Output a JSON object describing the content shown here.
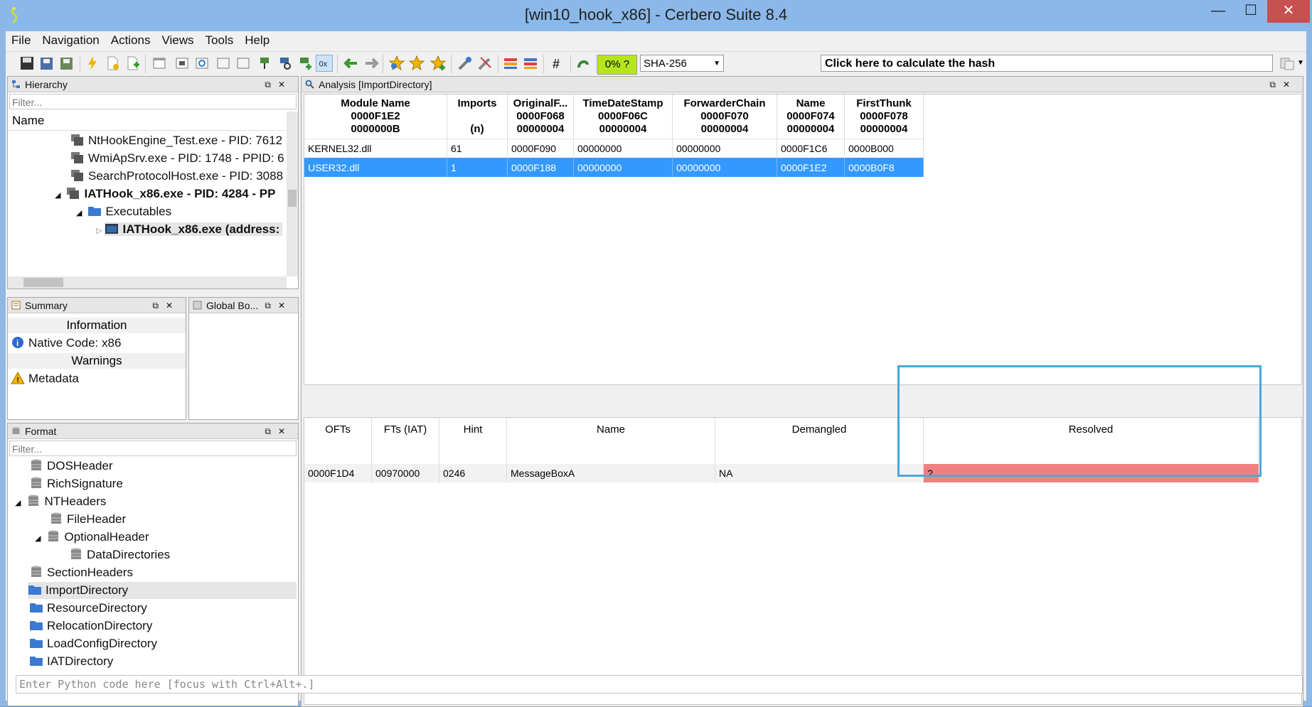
{
  "window": {
    "title": "[win10_hook_x86] - Cerbero Suite 8.4",
    "min_glyph": "—",
    "max_glyph": "☐",
    "close_glyph": "✕"
  },
  "menu": [
    "File",
    "Navigation",
    "Actions",
    "Views",
    "Tools",
    "Help"
  ],
  "toolbar": {
    "percent_label": "0% ?",
    "hash_algorithm": "SHA-256",
    "hash_button": "Click here to calculate the hash"
  },
  "hierarchy": {
    "title": "Hierarchy",
    "filter_placeholder": "Filter...",
    "column": "Name",
    "rows": [
      "NtHookEngine_Test.exe - PID: 7612",
      "WmiApSrv.exe - PID: 1748 - PPID: 6",
      "SearchProtocolHost.exe - PID: 3088",
      "IATHook_x86.exe - PID: 4284 - PP",
      "Executables",
      "IATHook_x86.exe (address:"
    ]
  },
  "summary": {
    "title": "Summary",
    "sections": {
      "information": "Information",
      "warnings": "Warnings"
    },
    "native_code": "Native Code: x86",
    "metadata": "Metadata"
  },
  "global_bookmarks": {
    "title": "Global Bo..."
  },
  "format": {
    "title": "Format",
    "filter_placeholder": "Filter...",
    "items": [
      "DOSHeader",
      "RichSignature",
      "NTHeaders",
      "FileHeader",
      "OptionalHeader",
      "DataDirectories",
      "SectionHeaders",
      "ImportDirectory",
      "ResourceDirectory",
      "RelocationDirectory",
      "LoadConfigDirectory",
      "IATDirectory"
    ]
  },
  "analysis": {
    "title": "Analysis [ImportDirectory]",
    "top_columns": [
      [
        "Module Name",
        "0000F1E2",
        "0000000B"
      ],
      [
        "Imports",
        "",
        "(n)"
      ],
      [
        "OriginalF...",
        "0000F068",
        "00000004"
      ],
      [
        "TimeDateStamp",
        "0000F06C",
        "00000004"
      ],
      [
        "ForwarderChain",
        "0000F070",
        "00000004"
      ],
      [
        "Name",
        "0000F074",
        "00000004"
      ],
      [
        "FirstThunk",
        "0000F078",
        "00000004"
      ]
    ],
    "top_rows": [
      [
        "KERNEL32.dll",
        "61",
        "0000F090",
        "00000000",
        "00000000",
        "0000F1C6",
        "0000B000"
      ],
      [
        "USER32.dll",
        "1",
        "0000F188",
        "00000000",
        "00000000",
        "0000F1E2",
        "0000B0F8"
      ]
    ],
    "bottom_columns": [
      "OFTs",
      "FTs (IAT)",
      "Hint",
      "Name",
      "Demangled",
      "Resolved"
    ],
    "bottom_rows": [
      [
        "0000F1D4",
        "00970000",
        "0246",
        "MessageBoxA",
        "NA",
        "?"
      ]
    ],
    "selected_row_color": "#3399ff",
    "resolved_bad_color": "#f08080"
  },
  "console": {
    "placeholder": "Enter Python code here [focus with Ctrl+Alt+.]"
  }
}
